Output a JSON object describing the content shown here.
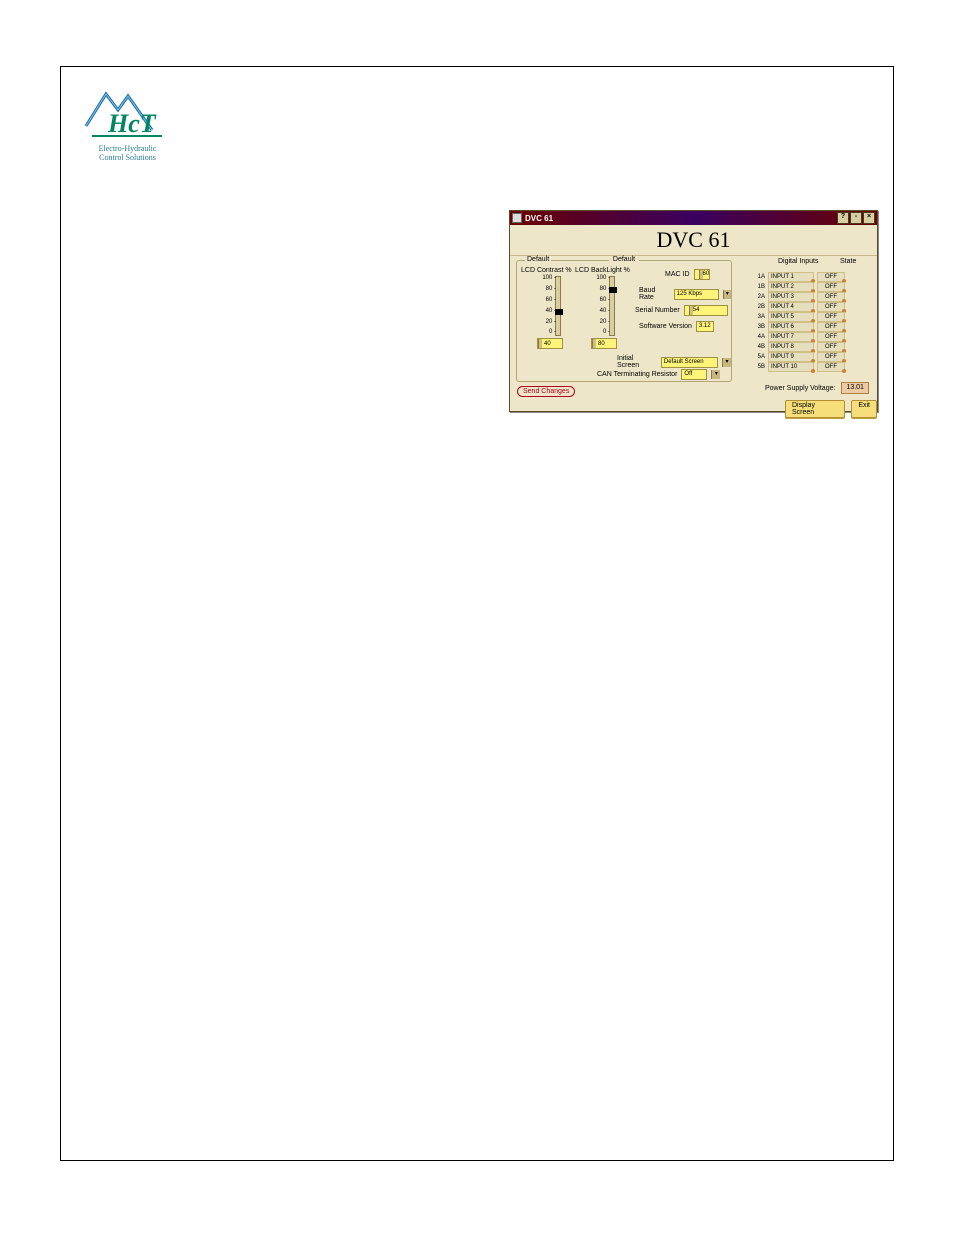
{
  "logo": {
    "line1": "Electro-Hydraulic",
    "line2": "Control Solutions",
    "brand": "HcT"
  },
  "panel": {
    "window_title": "DVC 61",
    "title": "DVC 61",
    "defaults_legend": "Default",
    "defaults_heading": "Default",
    "slider1_label": "LCD Contrast %",
    "slider2_label": "LCD BackLight %",
    "ticks": [
      "100 -",
      "80 -",
      "60 -",
      "40 -",
      "20 -",
      "0 -"
    ],
    "slider1_val": "40",
    "slider2_val": "80",
    "mac_label": "MAC ID",
    "mac_val": "60",
    "baud_label": "Baud Rate",
    "baud_val": "125 Kbps",
    "serial_label": "Serial Number",
    "serial_val": "54",
    "sw_label": "Software Version",
    "sw_val": "3.12",
    "initial_label": "Initial Screen",
    "initial_val": "Default Screen",
    "can_label": "CAN Terminating Resistor",
    "can_val": "Off",
    "send_label": "Send Changes",
    "di_header": "Digital Inputs",
    "state_header": "State",
    "digital_inputs": [
      {
        "num": "1A",
        "name": "INPUT 1",
        "state": "OFF"
      },
      {
        "num": "1B",
        "name": "INPUT 2",
        "state": "OFF"
      },
      {
        "num": "2A",
        "name": "INPUT 3",
        "state": "OFF"
      },
      {
        "num": "2B",
        "name": "INPUT 4",
        "state": "OFF"
      },
      {
        "num": "3A",
        "name": "INPUT 5",
        "state": "OFF"
      },
      {
        "num": "3B",
        "name": "INPUT 6",
        "state": "OFF"
      },
      {
        "num": "4A",
        "name": "INPUT 7",
        "state": "OFF"
      },
      {
        "num": "4B",
        "name": "INPUT 8",
        "state": "OFF"
      },
      {
        "num": "5A",
        "name": "INPUT 9",
        "state": "OFF"
      },
      {
        "num": "5B",
        "name": "INPUT 10",
        "state": "OFF"
      }
    ],
    "psv_label": "Power Supply Voltage:",
    "psv_val": "13.01",
    "display_btn": "Display Screen",
    "exit_btn": "Exit"
  }
}
